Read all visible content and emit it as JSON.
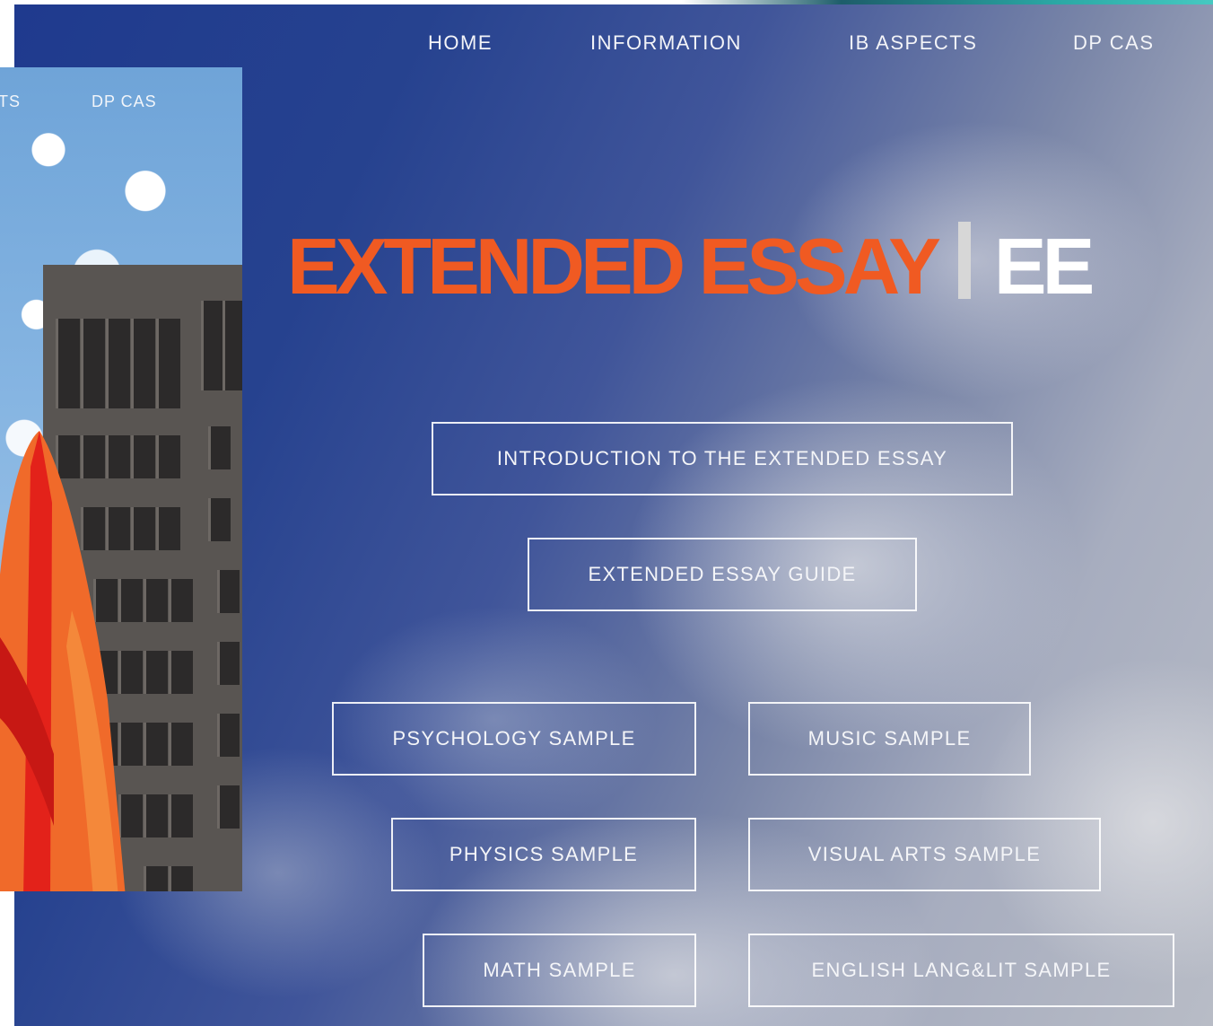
{
  "nav": {
    "home": "HOME",
    "information": "INFORMATION",
    "ib_aspects": "IB ASPECTS",
    "dp_cas": "DP CAS"
  },
  "back_page_nav": {
    "partial_left": "TS",
    "dp_cas": "DP CAS"
  },
  "hero": {
    "title_main": "EXTENDED ESSAY",
    "title_abbr": "EE"
  },
  "buttons": {
    "intro": "INTRODUCTION TO THE EXTENDED ESSAY",
    "guide": "EXTENDED ESSAY GUIDE",
    "psychology": "PSYCHOLOGY SAMPLE",
    "music": "MUSIC SAMPLE",
    "physics": "PHYSICS SAMPLE",
    "visual_arts": "VISUAL ARTS SAMPLE",
    "math": "MATH SAMPLE",
    "english": "ENGLISH LANG&LIT SAMPLE"
  },
  "colors": {
    "accent_orange": "#f05a22",
    "title_white": "#ffffff",
    "sky_dark_blue": "#1f3a8e"
  }
}
